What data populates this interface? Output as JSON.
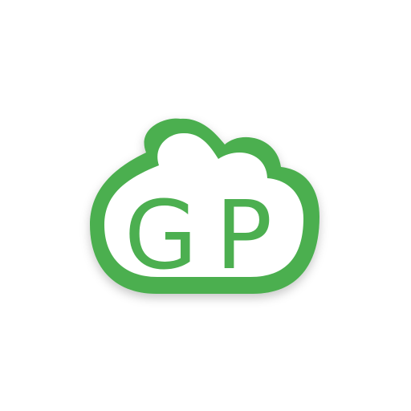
{
  "icon": {
    "name": "gp-cloud-icon",
    "logo_text": "GP",
    "colors": {
      "brand_green": "#4caf50",
      "fill": "#ffffff",
      "background": "#ffffff",
      "shadow": "#000000"
    }
  }
}
